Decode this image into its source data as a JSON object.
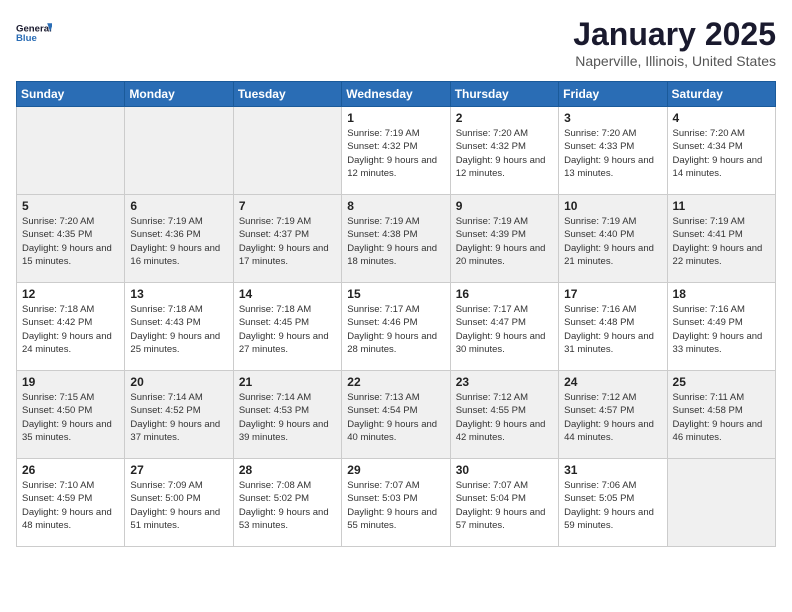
{
  "logo": {
    "line1": "General",
    "line2": "Blue"
  },
  "title": "January 2025",
  "location": "Naperville, Illinois, United States",
  "weekdays": [
    "Sunday",
    "Monday",
    "Tuesday",
    "Wednesday",
    "Thursday",
    "Friday",
    "Saturday"
  ],
  "rows": [
    [
      {
        "day": "",
        "empty": true
      },
      {
        "day": "",
        "empty": true
      },
      {
        "day": "",
        "empty": true
      },
      {
        "day": "1",
        "sunrise": "7:19 AM",
        "sunset": "4:32 PM",
        "daylight": "9 hours and 12 minutes."
      },
      {
        "day": "2",
        "sunrise": "7:20 AM",
        "sunset": "4:32 PM",
        "daylight": "9 hours and 12 minutes."
      },
      {
        "day": "3",
        "sunrise": "7:20 AM",
        "sunset": "4:33 PM",
        "daylight": "9 hours and 13 minutes."
      },
      {
        "day": "4",
        "sunrise": "7:20 AM",
        "sunset": "4:34 PM",
        "daylight": "9 hours and 14 minutes."
      }
    ],
    [
      {
        "day": "5",
        "sunrise": "7:20 AM",
        "sunset": "4:35 PM",
        "daylight": "9 hours and 15 minutes."
      },
      {
        "day": "6",
        "sunrise": "7:19 AM",
        "sunset": "4:36 PM",
        "daylight": "9 hours and 16 minutes."
      },
      {
        "day": "7",
        "sunrise": "7:19 AM",
        "sunset": "4:37 PM",
        "daylight": "9 hours and 17 minutes."
      },
      {
        "day": "8",
        "sunrise": "7:19 AM",
        "sunset": "4:38 PM",
        "daylight": "9 hours and 18 minutes."
      },
      {
        "day": "9",
        "sunrise": "7:19 AM",
        "sunset": "4:39 PM",
        "daylight": "9 hours and 20 minutes."
      },
      {
        "day": "10",
        "sunrise": "7:19 AM",
        "sunset": "4:40 PM",
        "daylight": "9 hours and 21 minutes."
      },
      {
        "day": "11",
        "sunrise": "7:19 AM",
        "sunset": "4:41 PM",
        "daylight": "9 hours and 22 minutes."
      }
    ],
    [
      {
        "day": "12",
        "sunrise": "7:18 AM",
        "sunset": "4:42 PM",
        "daylight": "9 hours and 24 minutes."
      },
      {
        "day": "13",
        "sunrise": "7:18 AM",
        "sunset": "4:43 PM",
        "daylight": "9 hours and 25 minutes."
      },
      {
        "day": "14",
        "sunrise": "7:18 AM",
        "sunset": "4:45 PM",
        "daylight": "9 hours and 27 minutes."
      },
      {
        "day": "15",
        "sunrise": "7:17 AM",
        "sunset": "4:46 PM",
        "daylight": "9 hours and 28 minutes."
      },
      {
        "day": "16",
        "sunrise": "7:17 AM",
        "sunset": "4:47 PM",
        "daylight": "9 hours and 30 minutes."
      },
      {
        "day": "17",
        "sunrise": "7:16 AM",
        "sunset": "4:48 PM",
        "daylight": "9 hours and 31 minutes."
      },
      {
        "day": "18",
        "sunrise": "7:16 AM",
        "sunset": "4:49 PM",
        "daylight": "9 hours and 33 minutes."
      }
    ],
    [
      {
        "day": "19",
        "sunrise": "7:15 AM",
        "sunset": "4:50 PM",
        "daylight": "9 hours and 35 minutes."
      },
      {
        "day": "20",
        "sunrise": "7:14 AM",
        "sunset": "4:52 PM",
        "daylight": "9 hours and 37 minutes."
      },
      {
        "day": "21",
        "sunrise": "7:14 AM",
        "sunset": "4:53 PM",
        "daylight": "9 hours and 39 minutes."
      },
      {
        "day": "22",
        "sunrise": "7:13 AM",
        "sunset": "4:54 PM",
        "daylight": "9 hours and 40 minutes."
      },
      {
        "day": "23",
        "sunrise": "7:12 AM",
        "sunset": "4:55 PM",
        "daylight": "9 hours and 42 minutes."
      },
      {
        "day": "24",
        "sunrise": "7:12 AM",
        "sunset": "4:57 PM",
        "daylight": "9 hours and 44 minutes."
      },
      {
        "day": "25",
        "sunrise": "7:11 AM",
        "sunset": "4:58 PM",
        "daylight": "9 hours and 46 minutes."
      }
    ],
    [
      {
        "day": "26",
        "sunrise": "7:10 AM",
        "sunset": "4:59 PM",
        "daylight": "9 hours and 48 minutes."
      },
      {
        "day": "27",
        "sunrise": "7:09 AM",
        "sunset": "5:00 PM",
        "daylight": "9 hours and 51 minutes."
      },
      {
        "day": "28",
        "sunrise": "7:08 AM",
        "sunset": "5:02 PM",
        "daylight": "9 hours and 53 minutes."
      },
      {
        "day": "29",
        "sunrise": "7:07 AM",
        "sunset": "5:03 PM",
        "daylight": "9 hours and 55 minutes."
      },
      {
        "day": "30",
        "sunrise": "7:07 AM",
        "sunset": "5:04 PM",
        "daylight": "9 hours and 57 minutes."
      },
      {
        "day": "31",
        "sunrise": "7:06 AM",
        "sunset": "5:05 PM",
        "daylight": "9 hours and 59 minutes."
      },
      {
        "day": "",
        "empty": true
      }
    ]
  ]
}
